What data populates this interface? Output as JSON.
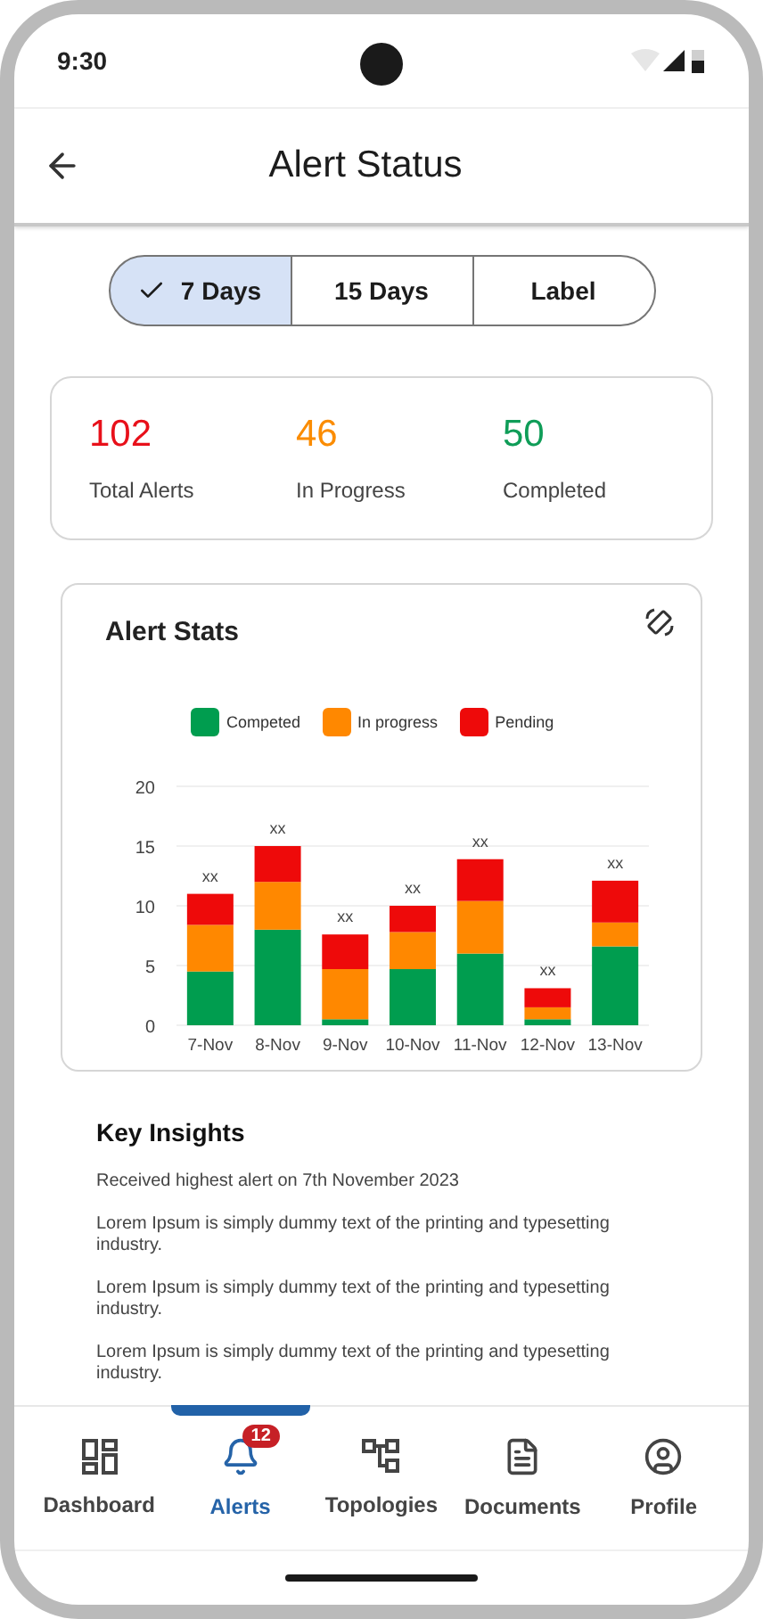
{
  "status_bar": {
    "time": "9:30"
  },
  "header": {
    "title": "Alert Status"
  },
  "segments": [
    {
      "label": "7 Days",
      "selected": true
    },
    {
      "label": "15 Days",
      "selected": false
    },
    {
      "label": "Label",
      "selected": false
    }
  ],
  "stats": [
    {
      "value": "102",
      "label": "Total Alerts",
      "color": "#e8101a"
    },
    {
      "value": "46",
      "label": "In Progress",
      "color": "#fb8c00"
    },
    {
      "value": "50",
      "label": "Completed",
      "color": "#0f9d58"
    }
  ],
  "chart_card": {
    "title": "Alert Stats",
    "chart_data": {
      "type": "bar",
      "stacked": true,
      "categories": [
        "7-Nov",
        "8-Nov",
        "9-Nov",
        "10-Nov",
        "11-Nov",
        "12-Nov",
        "13-Nov"
      ],
      "series": [
        {
          "name": "Competed",
          "color": "#009d4f",
          "values": [
            4.5,
            8,
            0.5,
            4.7,
            6,
            0.5,
            6.6
          ]
        },
        {
          "name": "In progress",
          "color": "#ff8800",
          "values": [
            3.9,
            4,
            4.2,
            3.1,
            4.4,
            1,
            2
          ]
        },
        {
          "name": "Pending",
          "color": "#ee0a0a",
          "values": [
            2.6,
            3,
            2.9,
            2.2,
            3.5,
            1.6,
            3.5
          ]
        }
      ],
      "ylim": [
        0,
        20
      ],
      "yticks": [
        0,
        5,
        10,
        15,
        20
      ],
      "grid": true,
      "annotations": [
        "xx",
        "xx",
        "xx",
        "xx",
        "xx",
        "xx",
        "xx"
      ]
    }
  },
  "insights": {
    "title": "Key Insights",
    "lines": [
      "Received highest alert on 7th November 2023",
      "Lorem Ipsum is simply dummy text of the printing and typesetting industry.",
      "Lorem Ipsum is simply dummy text of the printing and typesetting industry.",
      "Lorem Ipsum is simply dummy text of the printing and typesetting industry."
    ]
  },
  "nav": [
    {
      "kind": "dashboard",
      "label": "Dashboard",
      "selected": false
    },
    {
      "kind": "alerts",
      "label": "Alerts",
      "selected": true,
      "badge": "12"
    },
    {
      "kind": "topologies",
      "label": "Topologies",
      "selected": false
    },
    {
      "kind": "documents",
      "label": "Documents",
      "selected": false
    },
    {
      "kind": "profile",
      "label": "Profile",
      "selected": false
    }
  ]
}
